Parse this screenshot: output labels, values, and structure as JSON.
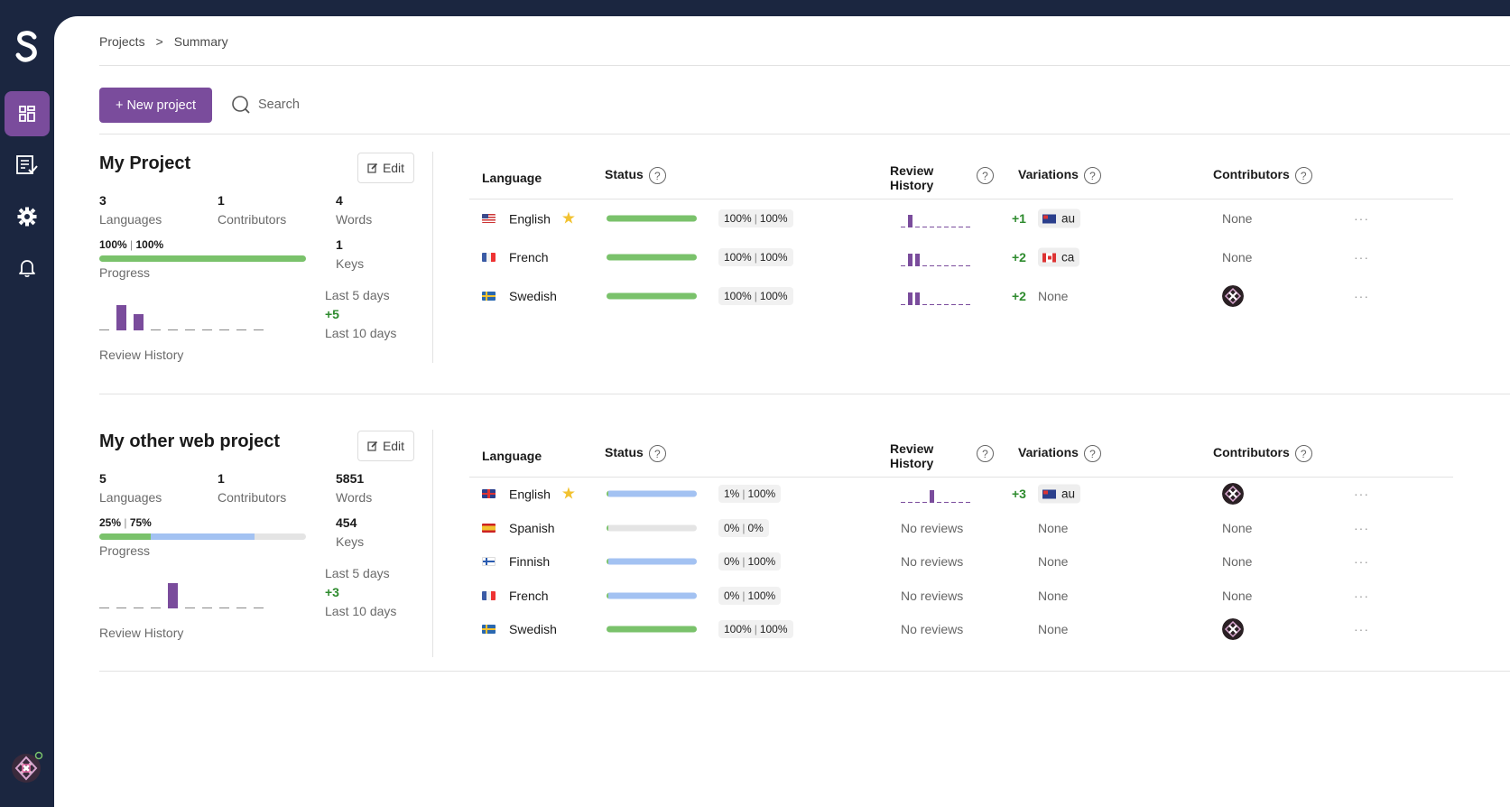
{
  "sidebar": {
    "logo": "S",
    "items": [
      {
        "icon": "dashboard-icon",
        "active": true
      },
      {
        "icon": "review-list-icon",
        "active": false
      },
      {
        "icon": "gear-icon",
        "active": false
      },
      {
        "icon": "bell-icon",
        "active": false
      }
    ],
    "user_avatar": "user-avatar-icon"
  },
  "breadcrumb": {
    "root": "Projects",
    "separator": ">",
    "current": "Summary"
  },
  "toolbar": {
    "new_project": "+ New project",
    "search": "Search"
  },
  "columns": {
    "language": "Language",
    "status": "Status",
    "review_history_1": "Review",
    "review_history_2": "History",
    "variations": "Variations",
    "contributors": "Contributors",
    "help": "?"
  },
  "projects": [
    {
      "title": "My Project",
      "edit": "Edit",
      "languages_count": "3",
      "languages_label": "Languages",
      "contributors_count": "1",
      "contributors_label": "Contributors",
      "words_count": "4",
      "words_label": "Words",
      "keys_count": "1",
      "keys_label": "Keys",
      "progress_a": "100%",
      "progress_b": "100%",
      "progress_green": 1.0,
      "progress_blue": 0.0,
      "progress_label": "Progress",
      "history_bars": [
        0,
        28,
        18,
        0,
        0,
        0,
        0,
        0,
        0,
        0
      ],
      "review_history_label": "Review History",
      "last5_label": "Last 5 days",
      "last_change": "+5",
      "last10_label": "Last 10 days",
      "rows": [
        {
          "flag": "us",
          "language": "English",
          "primary": true,
          "star": "★",
          "green": 1.0,
          "blue": 0.0,
          "pct_a": "100%",
          "pct_b": "100%",
          "history": [
            0,
            14,
            0,
            0,
            0,
            0,
            0,
            0,
            0,
            0
          ],
          "history_delta": "+1",
          "variation": {
            "flag": "au",
            "code": "au"
          },
          "contributors": "None"
        },
        {
          "flag": "fr",
          "language": "French",
          "primary": false,
          "green": 1.0,
          "blue": 0.0,
          "pct_a": "100%",
          "pct_b": "100%",
          "history": [
            0,
            14,
            14,
            0,
            0,
            0,
            0,
            0,
            0,
            0
          ],
          "history_delta": "+2",
          "variation": {
            "flag": "ca",
            "code": "ca"
          },
          "contributors": "None"
        },
        {
          "flag": "se",
          "language": "Swedish",
          "primary": false,
          "green": 1.0,
          "blue": 0.0,
          "pct_a": "100%",
          "pct_b": "100%",
          "history": [
            0,
            14,
            14,
            0,
            0,
            0,
            0,
            0,
            0,
            0
          ],
          "history_delta": "+2",
          "variation_none": "None",
          "contributor_avatar": true
        }
      ]
    },
    {
      "title": "My other web project",
      "edit": "Edit",
      "languages_count": "5",
      "languages_label": "Languages",
      "contributors_count": "1",
      "contributors_label": "Contributors",
      "words_count": "5851",
      "words_label": "Words",
      "keys_count": "454",
      "keys_label": "Keys",
      "progress_a": "25%",
      "progress_b": "75%",
      "progress_green": 0.25,
      "progress_blue": 0.5,
      "progress_label": "Progress",
      "history_bars": [
        0,
        0,
        0,
        0,
        28,
        0,
        0,
        0,
        0,
        0
      ],
      "review_history_label": "Review History",
      "last5_label": "Last 5 days",
      "last_change": "+3",
      "last10_label": "Last 10 days",
      "rows": [
        {
          "flag": "gb",
          "language": "English",
          "primary": true,
          "star": "★",
          "green": 0.0,
          "blue": 1.0,
          "pct_a": "1%",
          "pct_b": "100%",
          "history": [
            0,
            0,
            0,
            0,
            14,
            0,
            0,
            0,
            0,
            0
          ],
          "history_delta": "+3",
          "variation": {
            "flag": "au",
            "code": "au"
          },
          "contributor_avatar": true
        },
        {
          "flag": "es",
          "language": "Spanish",
          "primary": false,
          "green": 0.0,
          "blue": 0.0,
          "pct_a": "0%",
          "pct_b": "0%",
          "no_reviews": "No reviews",
          "variation_none": "None",
          "contributors": "None"
        },
        {
          "flag": "fi",
          "language": "Finnish",
          "primary": false,
          "green": 0.0,
          "blue": 1.0,
          "pct_a": "0%",
          "pct_b": "100%",
          "no_reviews": "No reviews",
          "variation_none": "None",
          "contributors": "None"
        },
        {
          "flag": "fr",
          "language": "French",
          "primary": false,
          "green": 0.0,
          "blue": 1.0,
          "pct_a": "0%",
          "pct_b": "100%",
          "no_reviews": "No reviews",
          "variation_none": "None",
          "contributors": "None"
        },
        {
          "flag": "se",
          "language": "Swedish",
          "primary": false,
          "green": 1.0,
          "blue": 0.0,
          "pct_a": "100%",
          "pct_b": "100%",
          "no_reviews": "No reviews",
          "variation_none": "None",
          "contributor_avatar": true
        }
      ]
    }
  ],
  "row_menu": "···",
  "colors": {
    "accent": "#7a4c9c",
    "sidebar": "#1b2640",
    "green": "#7ac26b",
    "blue": "#a3c2f2",
    "positive": "#2e8b2e"
  }
}
